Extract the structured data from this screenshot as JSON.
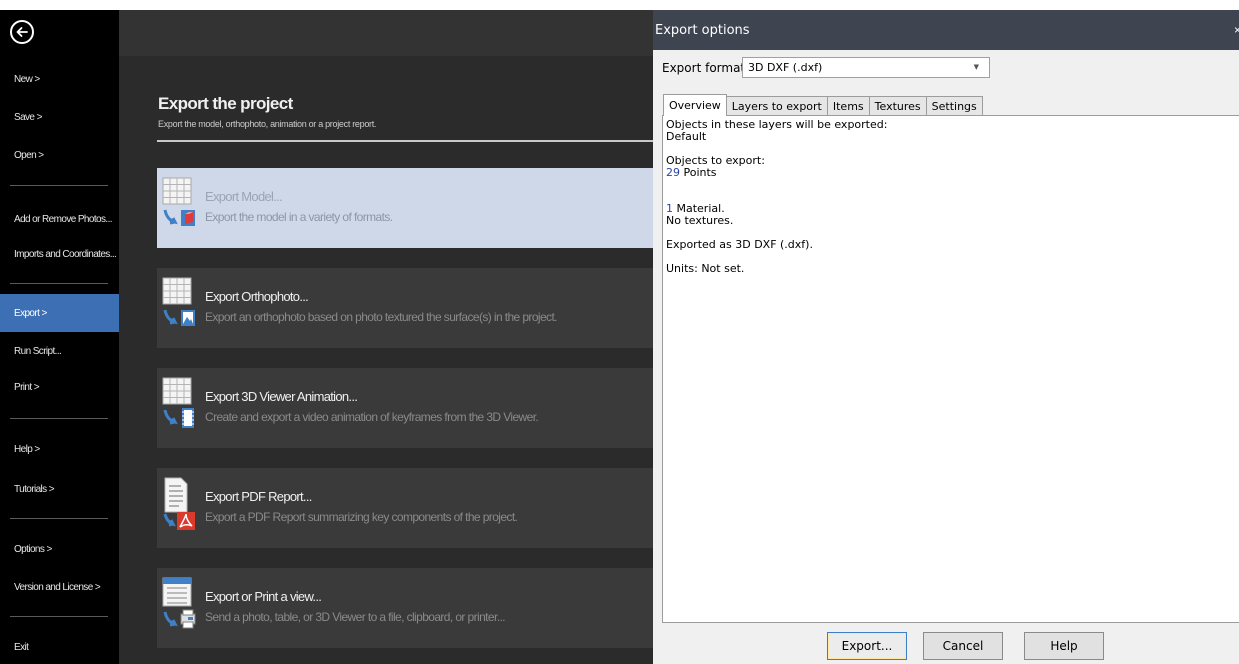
{
  "nav": {
    "items": [
      {
        "label": "New >"
      },
      {
        "label": "Save >"
      },
      {
        "label": "Open >"
      },
      {
        "label": "Add or Remove Photos..."
      },
      {
        "label": "Imports and Coordinates..."
      },
      {
        "label": "Export >"
      },
      {
        "label": "Run Script..."
      },
      {
        "label": "Print >"
      },
      {
        "label": "Help >"
      },
      {
        "label": "Tutorials >"
      },
      {
        "label": "Options >"
      },
      {
        "label": "Version and License >"
      },
      {
        "label": "Exit"
      }
    ],
    "active_label": "Export >",
    "accent_color": "#3d6fb5"
  },
  "center": {
    "title": "Export the project",
    "subtitle": "Export the model, orthophoto, animation or a project report.",
    "cards": [
      {
        "title": "Export Model...",
        "desc": "Export the model in a variety of formats.",
        "icon": "export-model-icon",
        "selected": true
      },
      {
        "title": "Export Orthophoto...",
        "desc": "Export an orthophoto based on photo textured the surface(s) in the project.",
        "icon": "export-orthophoto-icon"
      },
      {
        "title": "Export 3D Viewer Animation...",
        "desc": "Create and export a video animation of keyframes from the 3D Viewer.",
        "icon": "export-animation-icon"
      },
      {
        "title": "Export PDF Report...",
        "desc": "Export a PDF Report summarizing key components of the project.",
        "icon": "pdf-report-icon"
      },
      {
        "title": "Export or Print a view...",
        "desc": "Send a photo, table, or 3D Viewer to a file, clipboard, or printer...",
        "icon": "print-view-icon"
      }
    ]
  },
  "dialog": {
    "title": "Export options",
    "close_glyph": "×",
    "format_label": "Export format:",
    "format_value": "3D DXF (.dxf)",
    "tabs": [
      "Overview",
      "Layers to export",
      "Items",
      "Textures",
      "Settings"
    ],
    "active_tab": "Overview",
    "overview": {
      "layers_heading": "Objects in these layers will be exported:",
      "layers_value": "Default",
      "objects_heading": "Objects to export:",
      "points_count": "29",
      "points_label": "Points",
      "material_count": "1",
      "material_label": "Material.",
      "textures_text": "No textures.",
      "exported_as": "Exported as 3D DXF (.dxf).",
      "units": "Units: Not set."
    },
    "buttons": {
      "export": "Export...",
      "cancel": "Cancel",
      "help": "Help"
    }
  }
}
